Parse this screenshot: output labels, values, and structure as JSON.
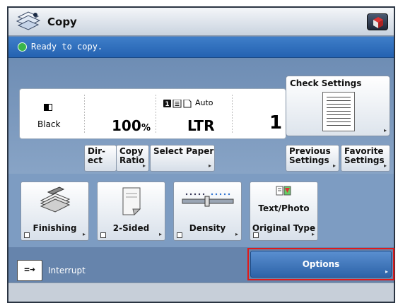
{
  "header": {
    "title": "Copy",
    "icons": {
      "app": "copy-pages-icon",
      "home": "home-cube-icon"
    }
  },
  "status": {
    "text": "Ready to copy.",
    "icon": "ready-status-icon",
    "color": "#39b54a"
  },
  "settings": {
    "color_mode": "Black",
    "copy_ratio": "100",
    "ratio_unit": "%",
    "paper_source": "Auto",
    "paper_size": "LTR",
    "copies": "1"
  },
  "buttons": {
    "check_settings": "Check Settings",
    "direct": "Dir-\nect",
    "copy_ratio": "Copy\nRatio",
    "select_paper": "Select Paper",
    "previous_settings": "Previous\nSettings",
    "favorite_settings": "Favorite\nSettings"
  },
  "functions": [
    {
      "label": "Finishing",
      "icon": "finishing-stack-icon"
    },
    {
      "label": "2-Sided",
      "icon": "two-sided-page-icon"
    },
    {
      "label": "Density",
      "icon": "density-slider-icon"
    },
    {
      "label": "Original Type",
      "sub": "Text/Photo",
      "icon": "original-type-icon"
    }
  ],
  "bottom": {
    "interrupt": "Interrupt",
    "options": "Options"
  },
  "colors": {
    "accent": "#2462b1",
    "highlight": "#e01a1a",
    "panel": "#6e8db4"
  }
}
